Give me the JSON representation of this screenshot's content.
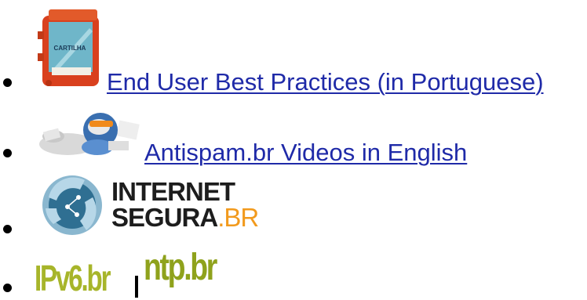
{
  "items": [
    {
      "label": " End User Best Practices (in Portuguese)",
      "logo_icon": "cartilha-booklet-icon",
      "logo_text": "CARTILHA"
    },
    {
      "label": " Antispam.br Videos in English",
      "logo_icon": "antispam-character-icon"
    },
    {
      "label": "",
      "logo_icon": "internet-segura-logo",
      "logo_text_top": "INTERNET",
      "logo_text_bottom": "SEGURA",
      "logo_text_accent": ".BR"
    },
    {
      "label": "",
      "logo_icons": [
        "ipv6-br-logo",
        "ntp-br-logo"
      ],
      "logo_text_1": "IPv6.br",
      "logo_text_2": "ntp.br"
    }
  ],
  "colors": {
    "link": "#1f2aa8",
    "cartilha_red": "#d9401e",
    "segura_orange": "#f29a1d",
    "ipv6_green": "#a7b52a",
    "ntp_green": "#8fa21c"
  }
}
